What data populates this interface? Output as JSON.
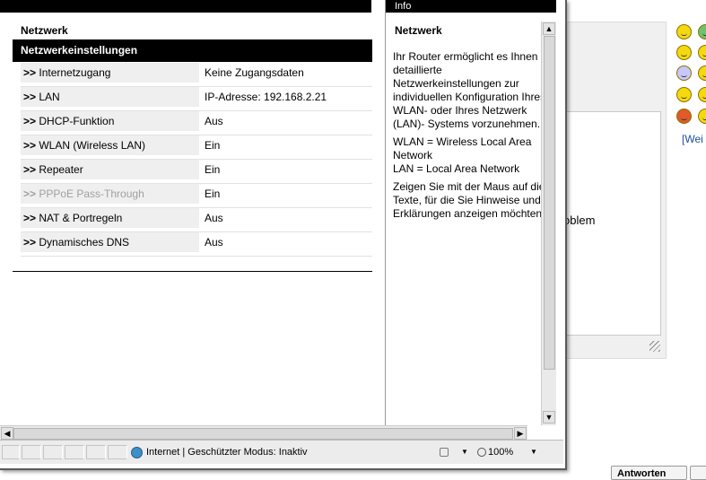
{
  "left_pane": {
    "section_title": "Netzwerk",
    "table_header": "Netzwerkeinstellungen",
    "prefix": ">>",
    "rows": [
      {
        "label": "Internetzugang",
        "value": "Keine Zugangsdaten",
        "disabled": false
      },
      {
        "label": "LAN",
        "value": "IP-Adresse: 192.168.2.21",
        "disabled": false
      },
      {
        "label": "DHCP-Funktion",
        "value": "Aus",
        "disabled": false
      },
      {
        "label": "WLAN (Wireless LAN)",
        "value": "Ein",
        "disabled": false
      },
      {
        "label": "Repeater",
        "value": "Ein",
        "disabled": false
      },
      {
        "label": "PPPoE Pass-Through",
        "value": "Ein",
        "disabled": true
      },
      {
        "label": "NAT & Portregeln",
        "value": "Aus",
        "disabled": false
      },
      {
        "label": "Dynamisches DNS",
        "value": "Aus",
        "disabled": false
      }
    ]
  },
  "info_pane": {
    "titlebar": "Info",
    "title": "Netzwerk",
    "paragraphs": [
      [
        "Ihr Router ermöglicht es Ihnen",
        "detaillierte",
        "Netzwerkeinstellungen zur",
        "individuellen Konfiguration Ihres",
        "WLAN- oder Ihres Netzwerk",
        "(LAN)- Systems vorzunehmen."
      ],
      [
        "WLAN = Wireless Local Area",
        "Network",
        "LAN = Local Area Network"
      ],
      [
        "Zeigen Sie mit der Maus auf die",
        "Texte, für die Sie Hinweise und",
        "Erklärungen anzeigen möchten."
      ]
    ]
  },
  "statusbar": {
    "zone_text": "Internet | Geschützter Modus: Inaktiv",
    "zoom": "100%"
  },
  "background": {
    "problem_text": "oblem",
    "weitere_link": "[Wei",
    "reply_button": "Antworten"
  }
}
